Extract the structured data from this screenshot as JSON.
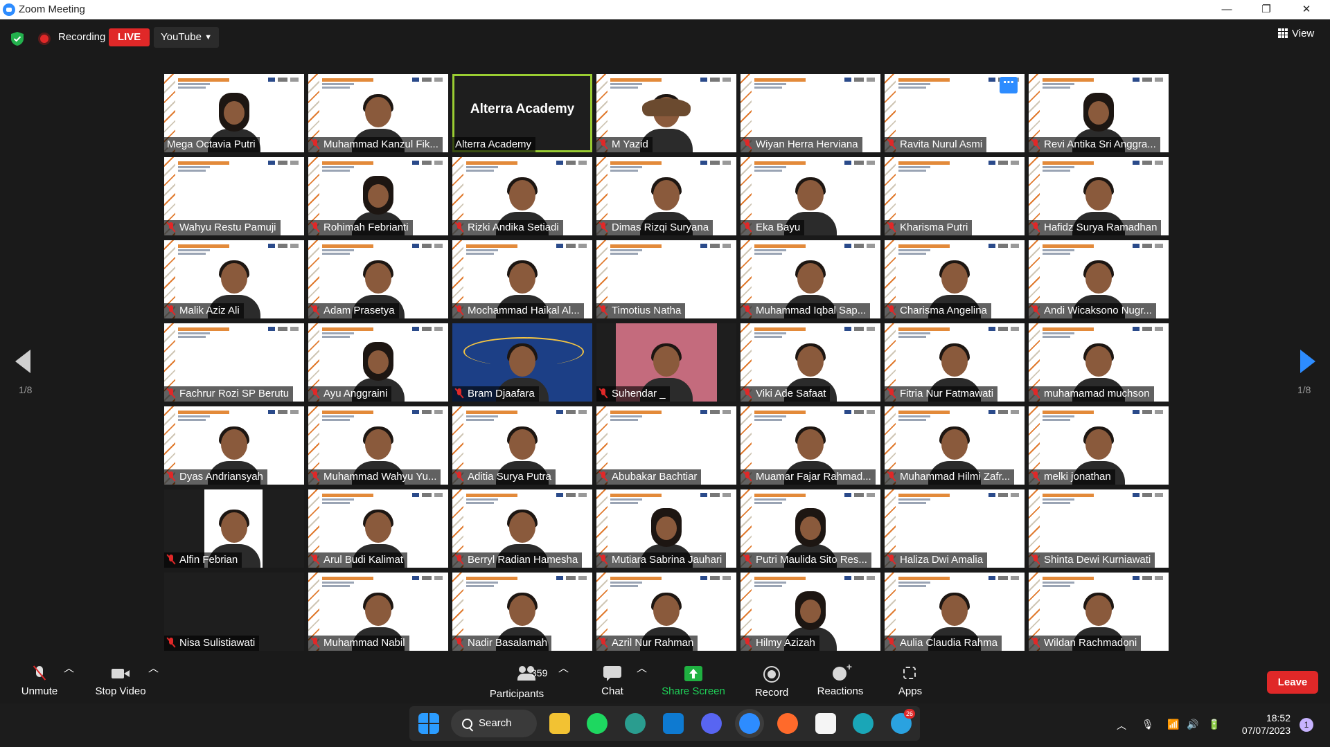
{
  "window": {
    "title": "Zoom Meeting",
    "minimize": "—",
    "restore": "❐",
    "close": "✕"
  },
  "topbar": {
    "recording_label": "Recording",
    "live_label": "LIVE",
    "stream_target": "YouTube",
    "view_label": "View"
  },
  "pager": {
    "left_indicator": "1/8",
    "right_indicator": "1/8"
  },
  "active_tile_text": "Alterra Academy",
  "participants_grid": [
    [
      "Mega Octavia Putri",
      "Muhammad Kanzul Fik...",
      "Alterra Academy",
      "M Yazid",
      "Wiyan Herra Herviana",
      "Ravita Nurul Asmi",
      "Revi Antika Sri Anggra..."
    ],
    [
      "Wahyu Restu Pamuji",
      "Rohimah Febrianti",
      "Rizki Andika Setiadi",
      "Dimas Rizqi Suryana",
      "Eka Bayu",
      "Kharisma Putri",
      "Hafidz Surya Ramadhan"
    ],
    [
      "Malik Aziz Ali",
      "Adam Prasetya",
      "Mochammad Haikal Al...",
      "Timotius Natha",
      "Muhammad Iqbal Sap...",
      "Charisma Angelina",
      "Andi Wicaksono Nugr..."
    ],
    [
      "Fachrur Rozi SP Berutu",
      "Ayu Anggraini",
      "Bram Djaafara",
      "Suhendar _",
      "Viki Ade Safaat",
      "Fitria Nur Fatmawati",
      "muhamamad muchson"
    ],
    [
      "Dyas Andriansyah",
      "Muhammad Wahyu Yu...",
      "Aditia Surya Putra",
      "Abubakar Bachtiar",
      "Muamar Fajar Rahmad...",
      "Muhammad Hilmi Zafr...",
      "melki jonathan"
    ],
    [
      "Alfin Febrian",
      "Arul Budi Kalimat",
      "Berryl Radian Hamesha",
      "Mutiara Sabrina Jauhari",
      "Putri Maulida Sito Res...",
      "Haliza Dwi Amalia",
      "Shinta Dewi Kurniawati"
    ],
    [
      "Nisa Sulistiawati",
      "Muhammad Nabil",
      "Nadir Basalamah",
      "Azril Nur Rahman",
      "Hilmy Azizah",
      "Aulia Claudia Rahma",
      "Wildan Rachmadoni"
    ]
  ],
  "controls": {
    "unmute": "Unmute",
    "stop_video": "Stop Video",
    "participants_count": "359",
    "participants": "Participants",
    "chat": "Chat",
    "share_screen": "Share Screen",
    "record": "Record",
    "reactions": "Reactions",
    "apps": "Apps",
    "leave": "Leave"
  },
  "taskbar": {
    "search_label": "Search",
    "telegram_badge": "26",
    "time": "18:52",
    "date": "07/07/2023",
    "notifications": "1"
  },
  "colors": {
    "accent": "#2d8cff",
    "live": "#e02828",
    "share": "#1fb141",
    "active_border": "#9acd32"
  }
}
